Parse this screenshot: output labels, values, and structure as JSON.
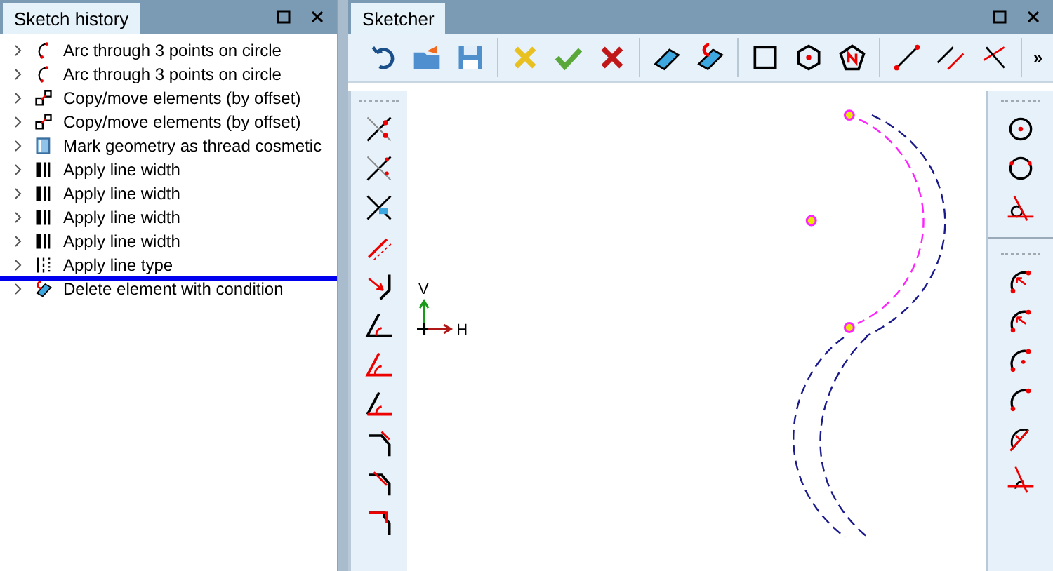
{
  "history_panel": {
    "title": "Sketch history",
    "items": [
      {
        "kind": "arc",
        "label": "Arc through 3 points on circle",
        "drop_marker": false
      },
      {
        "kind": "arc",
        "label": "Arc through 3 points on circle",
        "drop_marker": false
      },
      {
        "kind": "copy",
        "label": "Copy/move elements (by offset)",
        "drop_marker": false
      },
      {
        "kind": "copy",
        "label": "Copy/move elements (by offset)",
        "drop_marker": false
      },
      {
        "kind": "thread",
        "label": "Mark geometry as thread cosmetic",
        "drop_marker": false
      },
      {
        "kind": "linewidth",
        "label": "Apply line width",
        "drop_marker": false
      },
      {
        "kind": "linewidth",
        "label": "Apply line width",
        "drop_marker": false
      },
      {
        "kind": "linewidth",
        "label": "Apply line width",
        "drop_marker": false
      },
      {
        "kind": "linewidth",
        "label": "Apply line width",
        "drop_marker": false
      },
      {
        "kind": "linetype",
        "label": "Apply line type",
        "drop_marker": true
      },
      {
        "kind": "delete",
        "label": "Delete element with condition",
        "drop_marker": false
      }
    ]
  },
  "sketcher_panel": {
    "title": "Sketcher",
    "toolbar_overflow": "»",
    "canvas": {
      "axis_v": "V",
      "axis_h": "H"
    }
  }
}
